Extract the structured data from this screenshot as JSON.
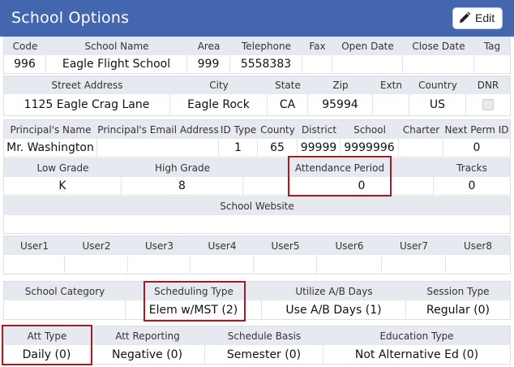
{
  "header": {
    "title": "School Options",
    "edit_label": "Edit"
  },
  "section1": {
    "headers": [
      "Code",
      "School Name",
      "Area",
      "Telephone",
      "Fax",
      "Open Date",
      "Close Date",
      "Tag"
    ],
    "values": [
      "996",
      "Eagle Flight School",
      "999",
      "5558383",
      "",
      "",
      "",
      ""
    ]
  },
  "section2": {
    "headers": [
      "Street Address",
      "City",
      "State",
      "Zip",
      "Extn",
      "Country",
      "DNR"
    ],
    "values": [
      "1125 Eagle Crag Lane",
      "Eagle Rock",
      "CA",
      "95994",
      "",
      "US",
      ""
    ]
  },
  "section3": {
    "headers": [
      "Principal's Name",
      "Principal's Email Address",
      "ID Type",
      "County",
      "District",
      "School",
      "Charter",
      "Next Perm ID"
    ],
    "values": [
      "Mr. Washington",
      "",
      "1",
      "65",
      "99999",
      "9999996",
      "",
      "0"
    ]
  },
  "section4": {
    "headers": [
      "Low Grade",
      "High Grade",
      "Attendance Period",
      "Tracks"
    ],
    "values": [
      "K",
      "8",
      "0",
      "0"
    ]
  },
  "section5": {
    "header": "School Website",
    "value": ""
  },
  "section6": {
    "headers": [
      "User1",
      "User2",
      "User3",
      "User4",
      "User5",
      "User6",
      "User7",
      "User8"
    ],
    "values": [
      "",
      "",
      "",
      "",
      "",
      "",
      "",
      ""
    ]
  },
  "section7": {
    "headers": [
      "School Category",
      "Scheduling Type",
      "Utilize A/B Days",
      "Session Type"
    ],
    "values": [
      "",
      "Elem w/MST (2)",
      "Use A/B Days (1)",
      "Regular (0)"
    ]
  },
  "section8": {
    "headers": [
      "Att Type",
      "Att Reporting",
      "Schedule Basis",
      "Education Type"
    ],
    "values": [
      "Daily (0)",
      "Negative (0)",
      "Semester (0)",
      "Not Alternative Ed (0)"
    ]
  },
  "colors": {
    "header_bg": "#4466ae",
    "label_row_bg": "#e6e9f0",
    "highlight": "#a31c24"
  }
}
